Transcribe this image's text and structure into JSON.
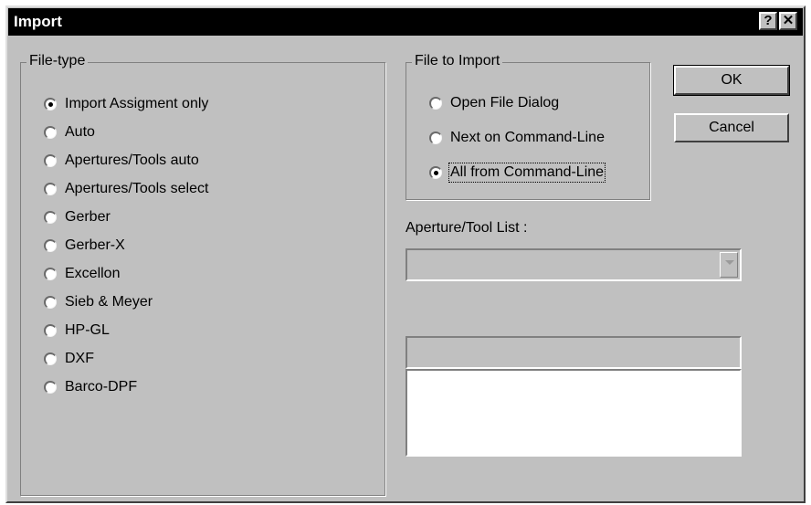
{
  "window": {
    "title": "Import",
    "help_label": "?",
    "close_label": "✕"
  },
  "file_type": {
    "legend": "File-type",
    "selected_index": 0,
    "options": [
      "Import Assigment only",
      "Auto",
      "Apertures/Tools auto",
      "Apertures/Tools select",
      "Gerber",
      "Gerber-X",
      "Excellon",
      "Sieb & Meyer",
      "HP-GL",
      "DXF",
      "Barco-DPF"
    ]
  },
  "file_to_import": {
    "legend": "File to Import",
    "selected_index": 2,
    "options": [
      "Open File Dialog",
      "Next on Command-Line",
      "All from Command-Line"
    ]
  },
  "buttons": {
    "ok": "OK",
    "cancel": "Cancel"
  },
  "aperture": {
    "label": "Aperture/Tool List :",
    "combo_value": "",
    "edit_value": "",
    "list_items": []
  },
  "colors": {
    "face": "#c0c0c0",
    "titlebar": "#000000",
    "title_text": "#ffffff"
  }
}
